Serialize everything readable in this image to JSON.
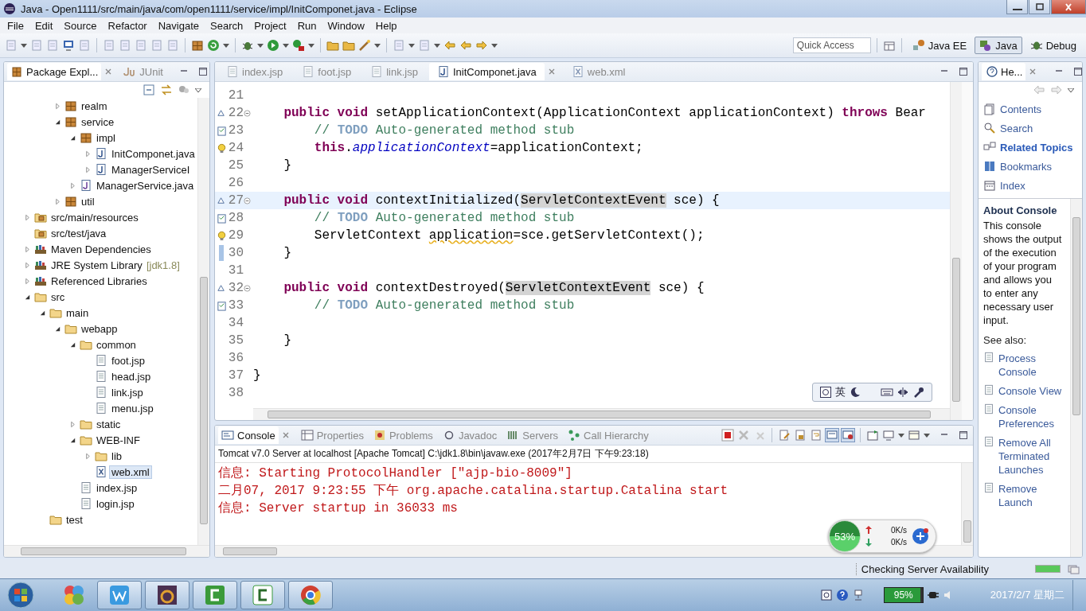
{
  "window": {
    "title": "Java - Open1111/src/main/java/com/open1111/service/impl/InitComponet.java - Eclipse"
  },
  "menu": [
    "File",
    "Edit",
    "Source",
    "Refactor",
    "Navigate",
    "Search",
    "Project",
    "Run",
    "Window",
    "Help"
  ],
  "quick_access": {
    "placeholder": "Quick Access"
  },
  "perspectives": [
    {
      "label": "Java EE",
      "kind": "javaee",
      "selected": false
    },
    {
      "label": "Java",
      "kind": "java",
      "selected": true
    },
    {
      "label": "Debug",
      "kind": "debug",
      "selected": false
    }
  ],
  "explorer": {
    "tabs": [
      {
        "label": "Package Expl...",
        "kind": "package",
        "selected": true
      },
      {
        "label": "JUnit",
        "kind": "junit",
        "selected": false
      }
    ],
    "items": [
      {
        "kind": "group",
        "children": [
          {
            "label": "realm",
            "kind": "package",
            "expanded": false
          },
          {
            "label": "service",
            "kind": "package",
            "expanded": true,
            "children": [
              {
                "label": "impl",
                "kind": "package",
                "expanded": true,
                "children": [
                  {
                    "label": "InitComponet.java",
                    "kind": "java",
                    "expanded": false
                  },
                  {
                    "label": "ManagerServiceI",
                    "kind": "java",
                    "expanded": false
                  }
                ]
              },
              {
                "label": "ManagerService.java",
                "kind": "interface",
                "expanded": false
              }
            ]
          },
          {
            "label": "util",
            "kind": "package",
            "expanded": false
          }
        ]
      },
      {
        "label": "src/main/resources",
        "kind": "srcfolder",
        "expanded": false
      },
      {
        "label": "src/test/java",
        "kind": "srcfolder"
      },
      {
        "label": "Maven Dependencies",
        "kind": "library",
        "expanded": false
      },
      {
        "label": "JRE System Library",
        "decoration": "[jdk1.8]",
        "kind": "library",
        "expanded": false
      },
      {
        "label": "Referenced Libraries",
        "kind": "library",
        "expanded": false
      },
      {
        "label": "src",
        "kind": "folder",
        "expanded": true,
        "children": [
          {
            "label": "main",
            "kind": "folder",
            "expanded": true,
            "children": [
              {
                "label": "webapp",
                "kind": "folder",
                "expanded": true,
                "children": [
                  {
                    "label": "common",
                    "kind": "folder",
                    "expanded": true,
                    "children": [
                      {
                        "label": "foot.jsp",
                        "kind": "file",
                        "selected": false
                      },
                      {
                        "label": "head.jsp",
                        "kind": "file",
                        "selected": false
                      },
                      {
                        "label": "link.jsp",
                        "kind": "file",
                        "selected": false
                      },
                      {
                        "label": "menu.jsp",
                        "kind": "file",
                        "selected": false
                      }
                    ]
                  },
                  {
                    "label": "static",
                    "kind": "folder",
                    "expanded": false
                  },
                  {
                    "label": "WEB-INF",
                    "kind": "folder",
                    "expanded": true,
                    "children": [
                      {
                        "label": "lib",
                        "kind": "folder",
                        "expanded": false
                      },
                      {
                        "label": "web.xml",
                        "kind": "xml",
                        "selected": true
                      }
                    ]
                  },
                  {
                    "label": "index.jsp",
                    "kind": "file",
                    "selected": false
                  },
                  {
                    "label": "login.jsp",
                    "kind": "file",
                    "selected": false
                  }
                ]
              }
            ]
          },
          {
            "label": "test",
            "kind": "folder"
          }
        ]
      }
    ]
  },
  "editor": {
    "tabs": [
      {
        "label": "index.jsp",
        "kind": "file",
        "selected": false
      },
      {
        "label": "foot.jsp",
        "kind": "file",
        "selected": false
      },
      {
        "label": "link.jsp",
        "kind": "file",
        "selected": false
      },
      {
        "label": "InitComponet.java",
        "kind": "java",
        "selected": true
      },
      {
        "label": "web.xml",
        "kind": "xml",
        "selected": false
      }
    ],
    "lines": [
      {
        "no": "21",
        "current": false
      },
      {
        "no": "22",
        "kind": "override",
        "current": false,
        "tokens": [
          {
            "text": "    public",
            "kind": "keyword"
          },
          {
            "text": " void",
            "kind": "keyword"
          },
          {
            "text": " setApplicationContext(ApplicationContext applicationContext) ",
            "kind": "plain"
          },
          {
            "text": "throws",
            "kind": "keyword"
          },
          {
            "text": " Bear",
            "kind": "plain"
          }
        ]
      },
      {
        "no": "23",
        "kind": "task",
        "current": false,
        "tokens": [
          {
            "text": "        // ",
            "kind": "comment"
          },
          {
            "text": "TODO",
            "kind": "todo"
          },
          {
            "text": " Auto-generated method stub",
            "kind": "comment"
          }
        ]
      },
      {
        "no": "24",
        "kind": "warning",
        "current": false,
        "tokens": [
          {
            "text": "        this",
            "kind": "keyword"
          },
          {
            "text": ".",
            "kind": "plain"
          },
          {
            "text": "applicationContext",
            "kind": "field"
          },
          {
            "text": "=applicationContext;",
            "kind": "plain"
          }
        ]
      },
      {
        "no": "25",
        "current": false,
        "tokens": [
          {
            "text": "    }",
            "kind": "plain"
          }
        ]
      },
      {
        "no": "26",
        "current": false
      },
      {
        "no": "27",
        "kind": "override",
        "current": true,
        "tokens": [
          {
            "text": "    public",
            "kind": "keyword"
          },
          {
            "text": " void",
            "kind": "keyword"
          },
          {
            "text": " contextInitialized(",
            "kind": "plain"
          },
          {
            "text": "ServletContextEvent",
            "kind": "highlight"
          },
          {
            "text": " sce) {",
            "kind": "plain"
          }
        ]
      },
      {
        "no": "28",
        "kind": "task",
        "current": false,
        "tokens": [
          {
            "text": "        // ",
            "kind": "comment"
          },
          {
            "text": "TODO",
            "kind": "todo"
          },
          {
            "text": " Auto-generated method stub",
            "kind": "comment"
          }
        ]
      },
      {
        "no": "29",
        "kind": "warning",
        "current": false,
        "tokens": [
          {
            "text": "        ServletContext ",
            "kind": "plain"
          },
          {
            "text": "application",
            "kind": "warning"
          },
          {
            "text": "=sce.getServletContext();",
            "kind": "plain"
          }
        ]
      },
      {
        "no": "30",
        "kind": "change",
        "current": false,
        "tokens": [
          {
            "text": "    }",
            "kind": "plain"
          }
        ]
      },
      {
        "no": "31",
        "current": false
      },
      {
        "no": "32",
        "kind": "override",
        "current": false,
        "tokens": [
          {
            "text": "    public",
            "kind": "keyword"
          },
          {
            "text": " void",
            "kind": "keyword"
          },
          {
            "text": " contextDestroyed(",
            "kind": "plain"
          },
          {
            "text": "ServletContextEvent",
            "kind": "highlight"
          },
          {
            "text": " sce) {",
            "kind": "plain"
          }
        ]
      },
      {
        "no": "33",
        "kind": "task",
        "current": false,
        "tokens": [
          {
            "text": "        // ",
            "kind": "comment"
          },
          {
            "text": "TODO",
            "kind": "todo"
          },
          {
            "text": " Auto-generated method stub",
            "kind": "comment"
          }
        ]
      },
      {
        "no": "34",
        "current": false
      },
      {
        "no": "35",
        "current": false,
        "tokens": [
          {
            "text": "    }",
            "kind": "plain"
          }
        ]
      },
      {
        "no": "36",
        "current": false
      },
      {
        "no": "37",
        "current": false,
        "tokens": [
          {
            "text": "}",
            "kind": "plain"
          }
        ]
      },
      {
        "no": "38",
        "current": false
      }
    ]
  },
  "console": {
    "tabs": [
      {
        "label": "Console",
        "kind": "console",
        "selected": true
      },
      {
        "label": "Properties",
        "kind": "properties",
        "selected": false
      },
      {
        "label": "Problems",
        "kind": "problems",
        "selected": false
      },
      {
        "label": "Javadoc",
        "kind": "javadoc",
        "selected": false
      },
      {
        "label": "Servers",
        "kind": "servers",
        "selected": false
      },
      {
        "label": "Call Hierarchy",
        "kind": "hierarchy",
        "selected": false
      }
    ],
    "header": "Tomcat v7.0 Server at localhost [Apache Tomcat] C:\\jdk1.8\\bin\\javaw.exe (2017年2月7日 下午9:23:18)",
    "lines": [
      "信息: Starting ProtocolHandler [\"ajp-bio-8009\"]",
      "二月07, 2017 9:23:55 下午 org.apache.catalina.startup.Catalina start",
      "信息: Server startup in 36033 ms"
    ]
  },
  "help": {
    "tab": "He...",
    "links": [
      {
        "label": "Contents",
        "kind": "contents",
        "selected": false
      },
      {
        "label": "Search",
        "kind": "search",
        "selected": false
      },
      {
        "label": "Related Topics",
        "kind": "related",
        "selected": true
      },
      {
        "label": "Bookmarks",
        "kind": "bookmarks",
        "selected": false
      },
      {
        "label": "Index",
        "kind": "index",
        "selected": false
      }
    ],
    "title": "About Console",
    "body": "This console shows the output of the execution of your program and allows you to enter any necessary user input.",
    "see_also_label": "See also:",
    "see_also": [
      "Process Console",
      "Console View",
      "Console Preferences",
      "Remove All Terminated Launches",
      "Remove Launch"
    ]
  },
  "ime_bar": {
    "mode": "英"
  },
  "net_monitor": {
    "usage": "53%",
    "upload": "0K/s",
    "download": "0K/s"
  },
  "status_bar": {
    "task": "Checking Server Availability",
    "level": 1
  },
  "taskbar": {
    "apps": [
      {
        "kind": "pinwheel"
      },
      {
        "kind": "writer"
      },
      {
        "kind": "ide"
      },
      {
        "kind": "recorder"
      },
      {
        "kind": "recorder-light"
      },
      {
        "kind": "browser"
      }
    ],
    "battery": {
      "text": "95%",
      "level": 0.95
    },
    "date": "2017/2/7 星期二"
  }
}
